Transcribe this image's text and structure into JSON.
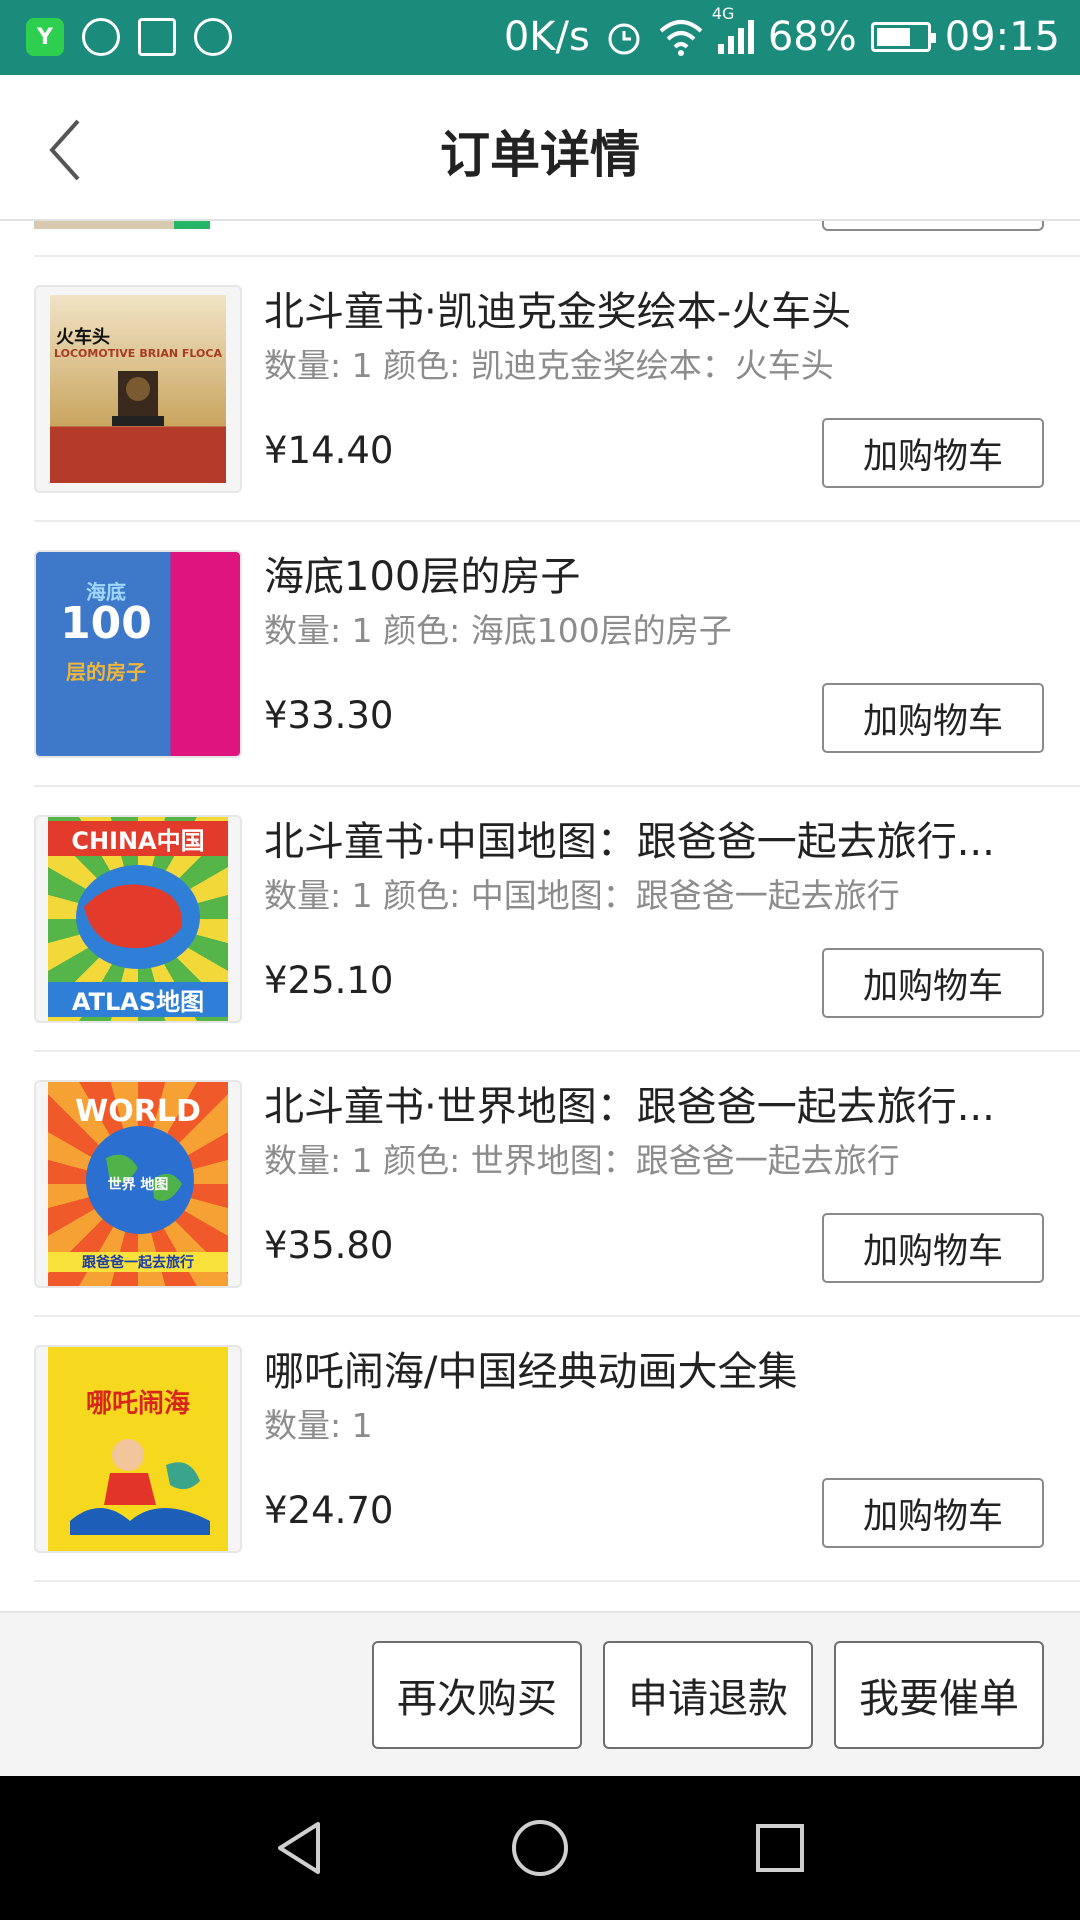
{
  "status_bar": {
    "left_icons": [
      "yz-app-icon",
      "wechat-icon",
      "gallery-icon",
      "vpn-icon"
    ],
    "yz_label": "Y",
    "net_speed": "0K/s",
    "network": "4G",
    "battery": "68%",
    "battery_level": 0.68,
    "time": "09:15",
    "bg_color": "#1b8c7c"
  },
  "header": {
    "title": "订单详情"
  },
  "items": [
    {
      "name": "北斗童书·凯迪克金奖绘本-火车头",
      "meta": "数量: 1 颜色: 凯迪克金奖绘本：火车头",
      "price": "¥14.40",
      "cart_label": "加购物车",
      "cover_title": "火车头",
      "cover_sub": "LOCOMOTIVE",
      "cover_author": "BRIAN FLOCA"
    },
    {
      "name": "海底100层的房子",
      "meta": "数量: 1 颜色: 海底100层的房子",
      "price": "¥33.30",
      "cart_label": "加购物车",
      "cover_title": "海底",
      "cover_sub": "100",
      "cover_author": "层的房子"
    },
    {
      "name": "北斗童书·中国地图：跟爸爸一起去旅行...",
      "meta": "数量: 1 颜色: 中国地图：跟爸爸一起去旅行",
      "price": "¥25.10",
      "cart_label": "加购物车",
      "cover_title": "CHINA中国",
      "cover_sub": "ATLAS地图",
      "cover_author": ""
    },
    {
      "name": "北斗童书·世界地图：跟爸爸一起去旅行...",
      "meta": "数量: 1 颜色: 世界地图：跟爸爸一起去旅行",
      "price": "¥35.80",
      "cart_label": "加购物车",
      "cover_title": "WORLD",
      "cover_sub": "世界 地图",
      "cover_author": "跟爸爸一起去旅行"
    },
    {
      "name": "哪吒闹海/中国经典动画大全集",
      "meta": "数量: 1",
      "price": "¥24.70",
      "cart_label": "加购物车",
      "cover_title": "哪吒闹海",
      "cover_sub": "",
      "cover_author": ""
    }
  ],
  "actions": {
    "buy_again": "再次购买",
    "refund": "申请退款",
    "urge": "我要催单"
  },
  "nav": {
    "icons": [
      "nav-back-icon",
      "nav-home-icon",
      "nav-recents-icon"
    ]
  }
}
